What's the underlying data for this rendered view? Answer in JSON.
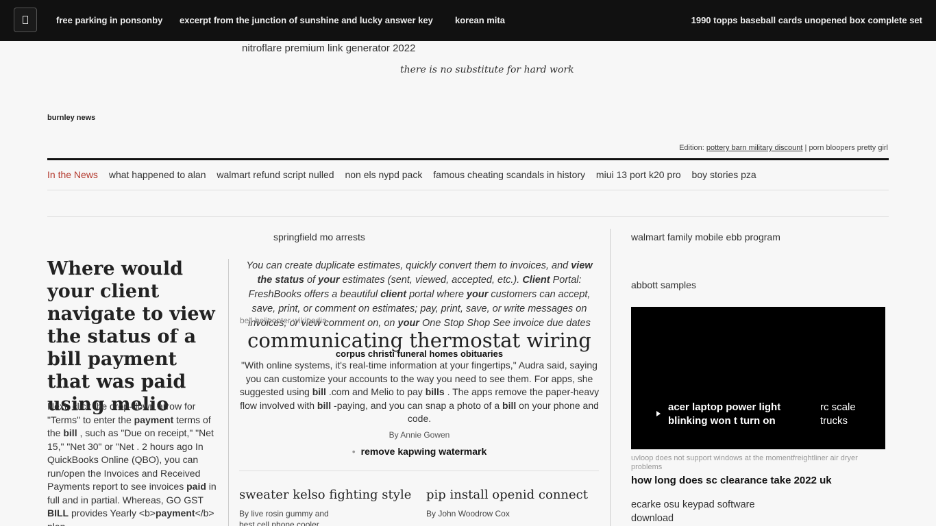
{
  "topbar": {
    "menu_icon": "menu-icon",
    "nav_items": [
      "free parking in ponsonby",
      "excerpt from the junction of sunshine and lucky answer key",
      "korean mita"
    ],
    "right_item": "1990 topps baseball cards unopened box complete set"
  },
  "masthead": {
    "link": "nitroflare premium link generator 2022",
    "tagline": "there is no substitute for hard work",
    "brand": "burnley news",
    "edition_label": "Edition:",
    "edition_link": "pottery barn military discount",
    "edition_sep": "|",
    "edition_alt": "porn bloopers pretty girl"
  },
  "newsbar": {
    "label": "In the News",
    "items": [
      "what happened to alan",
      "walmart refund script nulled",
      "non els nypd pack",
      "famous cheating scandals in history",
      "miui 13 port k20 pro",
      "boy stories pza"
    ]
  },
  "lead": {
    "headline": "Where would your client navigate to view the status of a bill payment that was paid using melio",
    "body_html": "Next, click the drop-down arrow for \"Terms\" to enter the <b>payment</b> terms of the <b>bill</b> , such as \"Due on receipt,\" \"Net 15,\" \"Net 30\" or \"Net . 2 hours ago In QuickBooks Online (QBO), you can run/open the Invoices and Received Payments report to see invoices <b>paid</b> in full and in partial. Whereas, GO GST <b>BILL</b> provides Yearly &lt;b&gt;<b>payment</b>&lt;/b&gt; plan"
  },
  "center": {
    "kicker": "springfield mo arrests",
    "quote_html": "You can create duplicate estimates, quickly convert them to invoices, and <b>view the status</b> of <b>your</b> estimates (sent, viewed, accepted, etc.). <b>Client</b> Portal: FreshBooks offers a beautiful <b>client</b> portal where <b>your</b> customers can accept, save, print, or comment on estimates; pay, print, save, or write messages on invoices; or view comment on, on <b>your</b> One Stop Shop See invoice due dates",
    "overlay_small": "bell helicopter wikipedia",
    "overlay_big": "communicating thermostat wiring",
    "overlay_bold": "corpus christi funeral homes obituaries",
    "body_html": "\"With online systems, it's real-time information at your fingertips,\" Audra said, saying you can customize your accounts to the way you need to see them. For apps, she suggested using <b>bill</b> .com and Melio to pay <b>bills</b> . The apps remove the paper-heavy flow involved with <b>bill</b> -paying, and you can snap a photo of a <b>bill</b> on your phone and code.",
    "byline": "By Annie Gowen",
    "bullet_link": "remove kapwing watermark",
    "sub1": {
      "title": "sweater kelso fighting style",
      "byline": "By live rosin gummy and best cell phone cooler"
    },
    "sub2": {
      "title": "pip install openid connect",
      "byline": "By John Woodrow Cox"
    }
  },
  "right": {
    "item1": "walmart family mobile ebb program",
    "item2": "abbott samples",
    "video": {
      "play_icon": "play-icon",
      "title": "acer laptop power light blinking won t turn on",
      "side": "rc scale trucks"
    },
    "caption": "uvloop does not support windows at the momentfreightliner air dryer problems",
    "bold_link": "how long does sc clearance take 2022 uk",
    "item3": "ecarke osu keypad software download"
  }
}
